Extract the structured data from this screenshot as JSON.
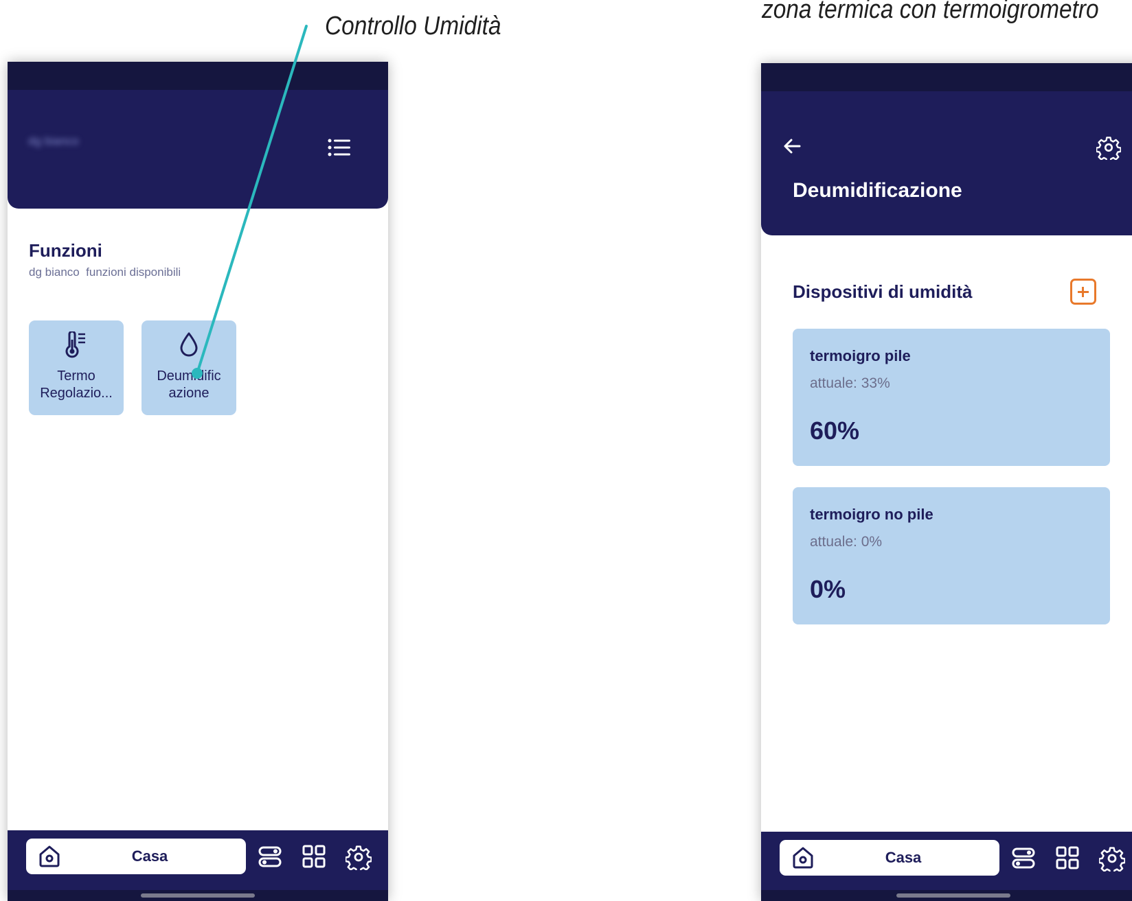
{
  "captions": {
    "left": "Controllo Umidità",
    "right": "zona termica con termoigrometro"
  },
  "left_screen": {
    "header": {
      "name_blurred": "dg bianco",
      "menu_icon": "list-icon"
    },
    "section": {
      "title": "Funzioni",
      "subtitle": "dg bianco  funzioni disponibili"
    },
    "tiles": [
      {
        "label": "Termo Regolazio...",
        "icon": "thermometer-icon"
      },
      {
        "label": "Deumidific azione",
        "icon": "water-drop-icon"
      }
    ],
    "navbar": {
      "home_label": "Casa",
      "icons": [
        "home-icon",
        "scenes-icon",
        "grid-icon",
        "gear-icon"
      ]
    }
  },
  "right_screen": {
    "header": {
      "title": "Deumidificazione",
      "back_icon": "arrow-left-icon",
      "settings_icon": "gear-icon"
    },
    "section": {
      "title": "Dispositivi di umidità",
      "add_icon": "plus-icon"
    },
    "devices": [
      {
        "name": "termoigro pile",
        "current": "attuale: 33%",
        "setpoint": "60%"
      },
      {
        "name": "termoigro no pile",
        "current": "attuale: 0%",
        "setpoint": "0%"
      }
    ],
    "navbar": {
      "home_label": "Casa"
    }
  },
  "colors": {
    "header": "#1e1d5a",
    "tile": "#b6d3ee",
    "accent_add": "#e8792b",
    "pointer": "#2bb8bd"
  }
}
